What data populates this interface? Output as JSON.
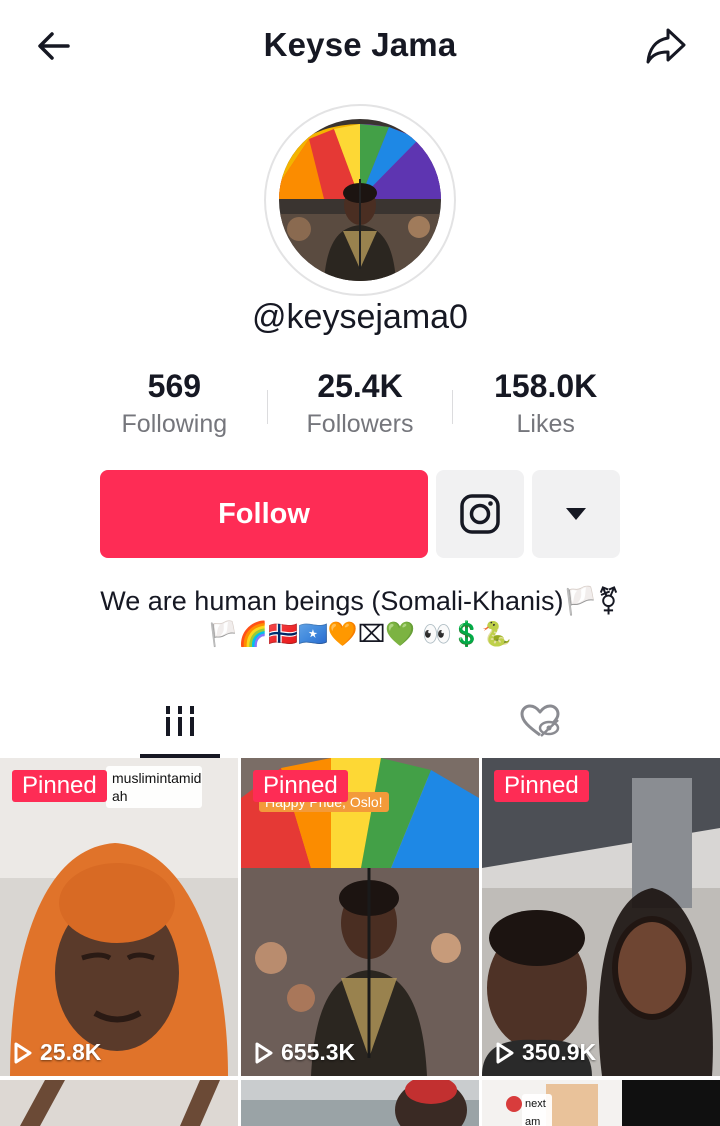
{
  "header": {
    "title": "Keyse Jama",
    "back_icon": "arrow-left-icon",
    "share_icon": "share-arrow-icon"
  },
  "profile": {
    "username": "@keysejama0",
    "avatar_icon": "profile-photo"
  },
  "stats": [
    {
      "value": "569",
      "label": "Following"
    },
    {
      "value": "25.4K",
      "label": "Followers"
    },
    {
      "value": "158.0K",
      "label": "Likes"
    }
  ],
  "actions": {
    "follow_label": "Follow",
    "instagram_icon": "instagram-icon",
    "more_icon": "caret-down-icon"
  },
  "bio": {
    "line1": "We are human beings (Somali-Khanis)🏳️⚧",
    "line2": "🏳️🌈🇳🇴🇸🇴🧡⌧💚 👀💲🐍"
  },
  "tabs": [
    {
      "icon": "videos-grid-icon",
      "selected": true
    },
    {
      "icon": "liked-hidden-icon",
      "selected": false
    }
  ],
  "videos": [
    {
      "badge": "Pinned",
      "views": "25.8K",
      "caption": "muslimintamid ah"
    },
    {
      "badge": "Pinned",
      "views": "655.3K",
      "caption": "Happy Pride, Oslo!"
    },
    {
      "badge": "Pinned",
      "views": "350.9K",
      "caption": ""
    },
    {
      "badge": "",
      "views": "",
      "caption": ""
    },
    {
      "badge": "",
      "views": "",
      "caption": ""
    },
    {
      "badge": "",
      "views": "",
      "caption": "next am g it"
    }
  ],
  "colors": {
    "accent": "#fe2c55",
    "text": "#161823",
    "muted": "#75767c",
    "button_gray": "#f1f1f2"
  }
}
